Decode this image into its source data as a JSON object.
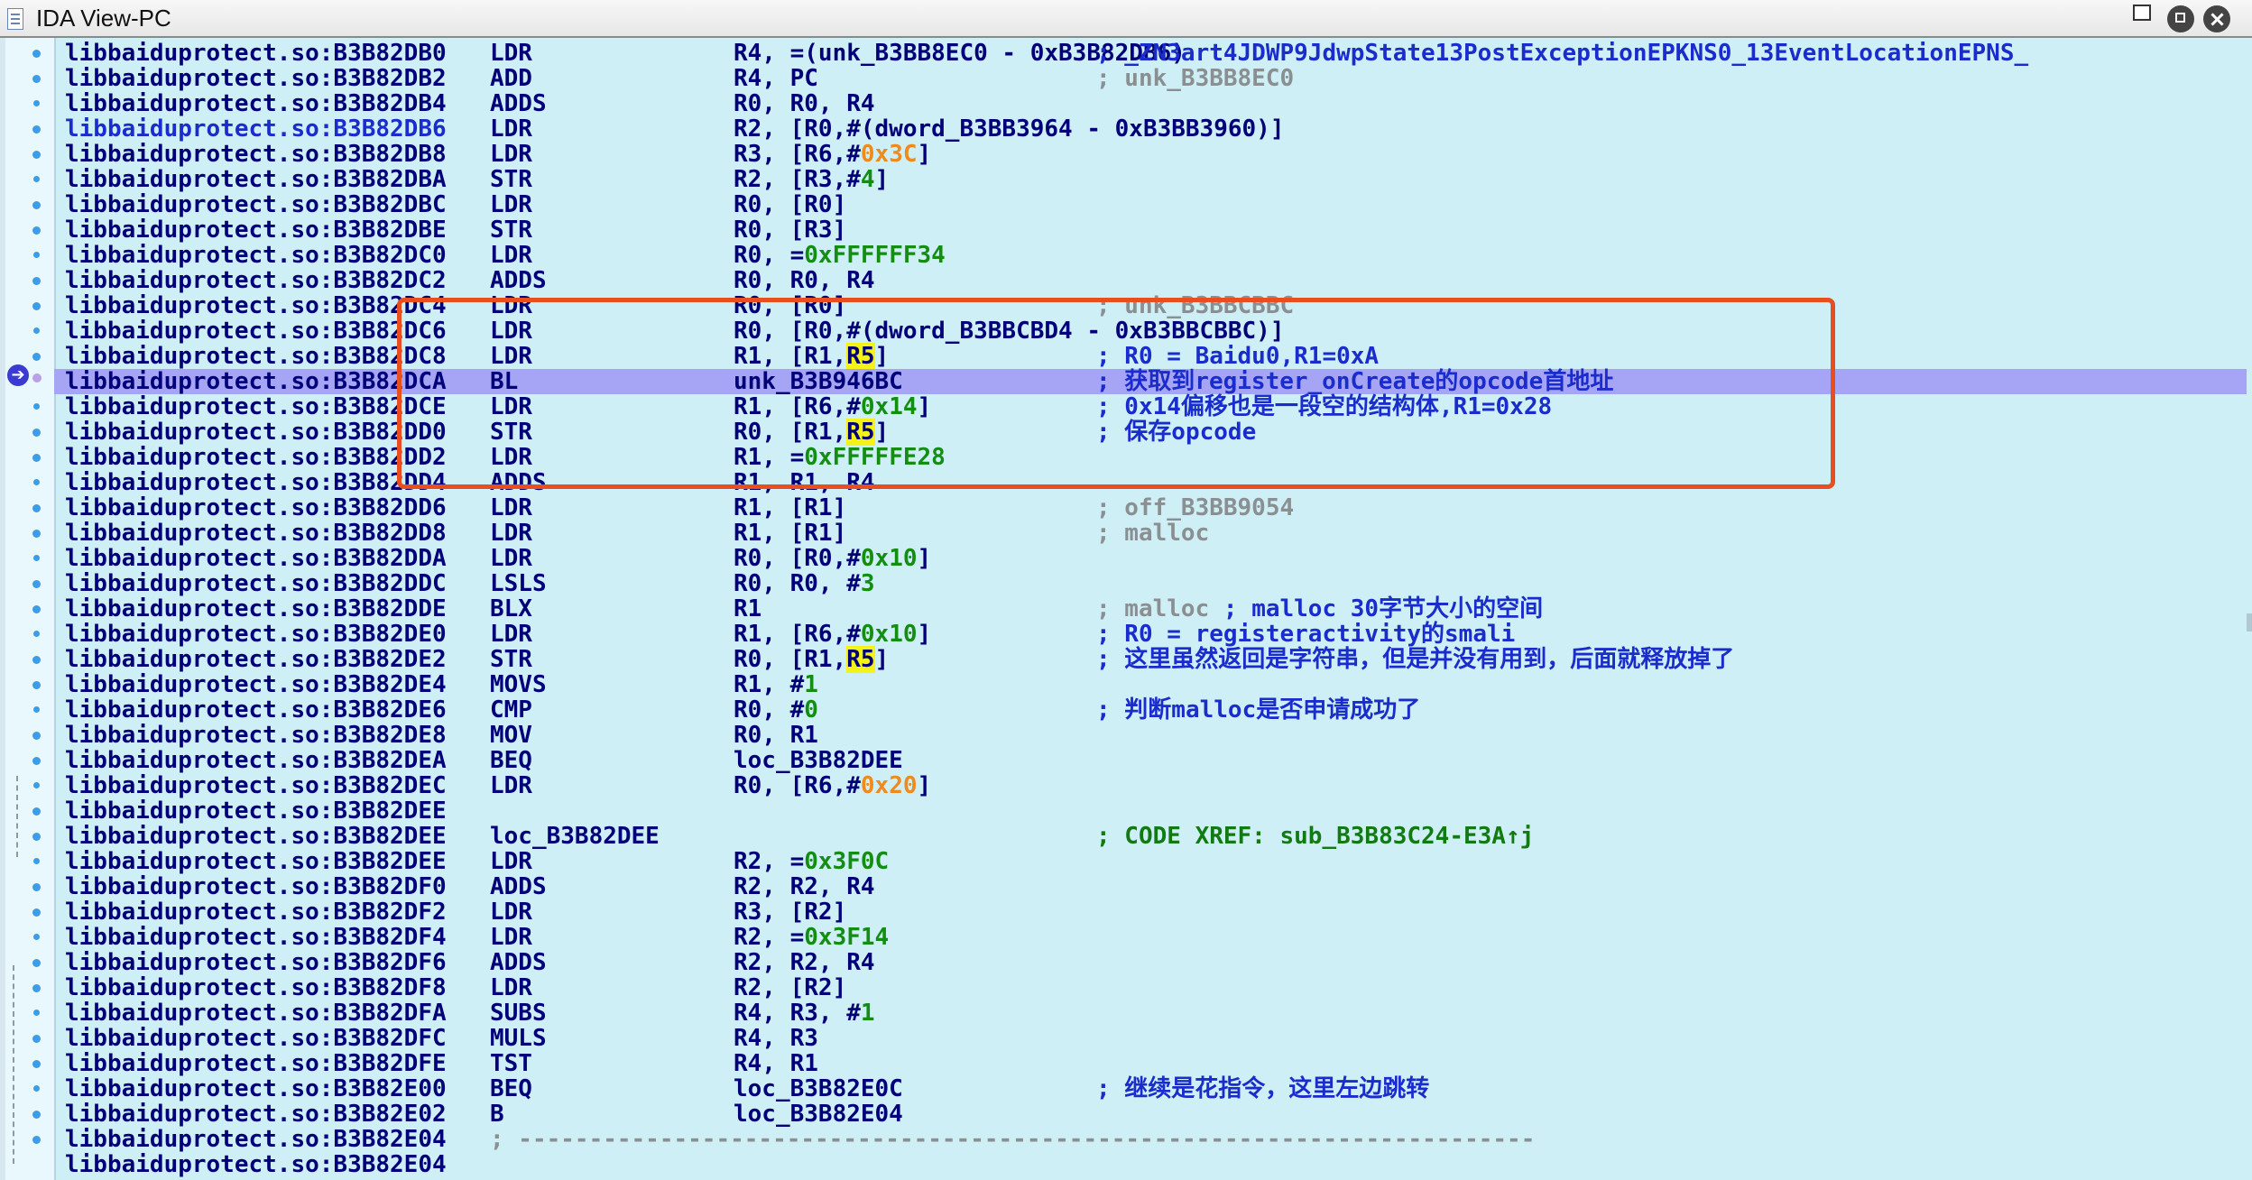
{
  "window": {
    "title": "IDA View-PC",
    "icons": [
      "document-icon",
      "restore-icon",
      "float-icon",
      "close-icon"
    ]
  },
  "lines": [
    {
      "addr": "libbaiduprotect.so:B3B82DB0",
      "mn": "LDR",
      "op": [
        {
          "t": "R4, =(unk_B3BB8EC0 - 0xB3B82DB6)"
        }
      ],
      "cm": "; _ZN3art4JDWP9JdwpState13PostExceptionEPKNS0_13EventLocationEPNS_",
      "cmc": "blue"
    },
    {
      "addr": "libbaiduprotect.so:B3B82DB2",
      "mn": "ADD",
      "op": [
        {
          "t": "R4, PC"
        }
      ],
      "cm": "; unk_B3BB8EC0",
      "cmc": "gray"
    },
    {
      "addr": "libbaiduprotect.so:B3B82DB4",
      "mn": "ADDS",
      "op": [
        {
          "t": "R0, R0, R4"
        }
      ]
    },
    {
      "addr": "libbaiduprotect.so:B3B82DB6",
      "addrc": "blue",
      "mn": "LDR",
      "op": [
        {
          "t": "R2, [R0,#(dword_B3BB3964 - 0xB3BB3960)]"
        }
      ]
    },
    {
      "addr": "libbaiduprotect.so:B3B82DB8",
      "mn": "LDR",
      "op": [
        {
          "t": "R3, [R6,#"
        },
        {
          "t": "0x3C",
          "c": "or"
        },
        {
          "t": "]"
        }
      ]
    },
    {
      "addr": "libbaiduprotect.so:B3B82DBA",
      "mn": "STR",
      "op": [
        {
          "t": "R2, [R3,#"
        },
        {
          "t": "4",
          "c": "gr"
        },
        {
          "t": "]"
        }
      ]
    },
    {
      "addr": "libbaiduprotect.so:B3B82DBC",
      "mn": "LDR",
      "op": [
        {
          "t": "R0, [R0]"
        }
      ]
    },
    {
      "addr": "libbaiduprotect.so:B3B82DBE",
      "mn": "STR",
      "op": [
        {
          "t": "R0, [R3]"
        }
      ]
    },
    {
      "addr": "libbaiduprotect.so:B3B82DC0",
      "mn": "LDR",
      "op": [
        {
          "t": "R0, ="
        },
        {
          "t": "0xFFFFFF34",
          "c": "gr"
        }
      ]
    },
    {
      "addr": "libbaiduprotect.so:B3B82DC2",
      "mn": "ADDS",
      "op": [
        {
          "t": "R0, R0, R4"
        }
      ]
    },
    {
      "addr": "libbaiduprotect.so:B3B82DC4",
      "mn": "LDR",
      "op": [
        {
          "t": "R0, [R0]"
        }
      ],
      "cm": "; unk_B3BBCBBC",
      "cmc": "gray"
    },
    {
      "addr": "libbaiduprotect.so:B3B82DC6",
      "mn": "LDR",
      "op": [
        {
          "t": "R0, [R0,#(dword_B3BBCBD4 - 0xB3BBCBBC)]"
        }
      ]
    },
    {
      "addr": "libbaiduprotect.so:B3B82DC8",
      "mn": "LDR",
      "op": [
        {
          "t": "R1, [R1,"
        },
        {
          "t": "R5",
          "c": "r5"
        },
        {
          "t": "]"
        }
      ],
      "cm": "; R0 = Baidu0,R1=0xA",
      "cmc": "blue"
    },
    {
      "addr": "libbaiduprotect.so:B3B82DCA",
      "mn": "BL",
      "op": [
        {
          "t": "unk_B3B946BC"
        }
      ],
      "cm": "; 获取到register_onCreate的opcode首地址",
      "cmc": "blue",
      "hl": true
    },
    {
      "addr": "libbaiduprotect.so:B3B82DCE",
      "mn": "LDR",
      "op": [
        {
          "t": "R1, [R6,#"
        },
        {
          "t": "0x14",
          "c": "gr"
        },
        {
          "t": "]"
        }
      ],
      "cm": "; 0x14偏移也是一段空的结构体,R1=0x28",
      "cmc": "blue"
    },
    {
      "addr": "libbaiduprotect.so:B3B82DD0",
      "mn": "STR",
      "op": [
        {
          "t": "R0, [R1,"
        },
        {
          "t": "R5",
          "c": "r5"
        },
        {
          "t": "]"
        }
      ],
      "cm": "; 保存opcode",
      "cmc": "blue"
    },
    {
      "addr": "libbaiduprotect.so:B3B82DD2",
      "mn": "LDR",
      "op": [
        {
          "t": "R1, ="
        },
        {
          "t": "0xFFFFFE28",
          "c": "gr"
        }
      ]
    },
    {
      "addr": "libbaiduprotect.so:B3B82DD4",
      "mn": "ADDS",
      "op": [
        {
          "t": "R1, R1, R4"
        }
      ]
    },
    {
      "addr": "libbaiduprotect.so:B3B82DD6",
      "mn": "LDR",
      "op": [
        {
          "t": "R1, [R1]"
        }
      ],
      "cm": "; off_B3BB9054",
      "cmc": "gray"
    },
    {
      "addr": "libbaiduprotect.so:B3B82DD8",
      "mn": "LDR",
      "op": [
        {
          "t": "R1, [R1]"
        }
      ],
      "cm": "; malloc",
      "cmc": "gray"
    },
    {
      "addr": "libbaiduprotect.so:B3B82DDA",
      "mn": "LDR",
      "op": [
        {
          "t": "R0, [R0,#"
        },
        {
          "t": "0x10",
          "c": "gr"
        },
        {
          "t": "]"
        }
      ]
    },
    {
      "addr": "libbaiduprotect.so:B3B82DDC",
      "mn": "LSLS",
      "op": [
        {
          "t": "R0, R0, #"
        },
        {
          "t": "3",
          "c": "gr"
        }
      ]
    },
    {
      "addr": "libbaiduprotect.so:B3B82DDE",
      "mn": "BLX",
      "op": [
        {
          "t": "R1"
        }
      ],
      "cmparts": [
        {
          "t": "; malloc",
          "c": "gray"
        },
        {
          "t": " ; malloc 30字节大小的空间",
          "c": "blue"
        }
      ]
    },
    {
      "addr": "libbaiduprotect.so:B3B82DE0",
      "mn": "LDR",
      "op": [
        {
          "t": "R1, [R6,#"
        },
        {
          "t": "0x10",
          "c": "gr"
        },
        {
          "t": "]"
        }
      ],
      "cm": "; R0 = registeractivity的smali",
      "cmc": "blue"
    },
    {
      "addr": "libbaiduprotect.so:B3B82DE2",
      "mn": "STR",
      "op": [
        {
          "t": "R0, [R1,"
        },
        {
          "t": "R5",
          "c": "r5"
        },
        {
          "t": "]"
        }
      ],
      "cm": "; 这里虽然返回是字符串，但是并没有用到，后面就释放掉了",
      "cmc": "blue"
    },
    {
      "addr": "libbaiduprotect.so:B3B82DE4",
      "mn": "MOVS",
      "op": [
        {
          "t": "R1, #"
        },
        {
          "t": "1",
          "c": "gr"
        }
      ]
    },
    {
      "addr": "libbaiduprotect.so:B3B82DE6",
      "mn": "CMP",
      "op": [
        {
          "t": "R0, #"
        },
        {
          "t": "0",
          "c": "gr"
        }
      ],
      "cm": "; 判断malloc是否申请成功了",
      "cmc": "blue"
    },
    {
      "addr": "libbaiduprotect.so:B3B82DE8",
      "mn": "MOV",
      "op": [
        {
          "t": "R0, R1"
        }
      ]
    },
    {
      "addr": "libbaiduprotect.so:B3B82DEA",
      "mn": "BEQ",
      "op": [
        {
          "t": "loc_B3B82DEE"
        }
      ]
    },
    {
      "addr": "libbaiduprotect.so:B3B82DEC",
      "mn": "LDR",
      "op": [
        {
          "t": "R0, [R6,#"
        },
        {
          "t": "0x20",
          "c": "or"
        },
        {
          "t": "]"
        }
      ]
    },
    {
      "addr": "libbaiduprotect.so:B3B82DEE",
      "mn": "",
      "op": []
    },
    {
      "addr": "libbaiduprotect.so:B3B82DEE",
      "mn": "loc_B3B82DEE",
      "op": [],
      "cm": "; CODE XREF: sub_B3B83C24-E3A↑j",
      "cmc": "green"
    },
    {
      "addr": "libbaiduprotect.so:B3B82DEE",
      "mn": "LDR",
      "op": [
        {
          "t": "R2, ="
        },
        {
          "t": "0x3F0C",
          "c": "gr"
        }
      ]
    },
    {
      "addr": "libbaiduprotect.so:B3B82DF0",
      "mn": "ADDS",
      "op": [
        {
          "t": "R2, R2, R4"
        }
      ]
    },
    {
      "addr": "libbaiduprotect.so:B3B82DF2",
      "mn": "LDR",
      "op": [
        {
          "t": "R3, [R2]"
        }
      ]
    },
    {
      "addr": "libbaiduprotect.so:B3B82DF4",
      "mn": "LDR",
      "op": [
        {
          "t": "R2, ="
        },
        {
          "t": "0x3F14",
          "c": "gr"
        }
      ]
    },
    {
      "addr": "libbaiduprotect.so:B3B82DF6",
      "mn": "ADDS",
      "op": [
        {
          "t": "R2, R2, R4"
        }
      ]
    },
    {
      "addr": "libbaiduprotect.so:B3B82DF8",
      "mn": "LDR",
      "op": [
        {
          "t": "R2, [R2]"
        }
      ]
    },
    {
      "addr": "libbaiduprotect.so:B3B82DFA",
      "mn": "SUBS",
      "op": [
        {
          "t": "R4, R3, #"
        },
        {
          "t": "1",
          "c": "gr"
        }
      ]
    },
    {
      "addr": "libbaiduprotect.so:B3B82DFC",
      "mn": "MULS",
      "op": [
        {
          "t": "R4, R3"
        }
      ]
    },
    {
      "addr": "libbaiduprotect.so:B3B82DFE",
      "mn": "TST",
      "op": [
        {
          "t": "R4, R1"
        }
      ]
    },
    {
      "addr": "libbaiduprotect.so:B3B82E00",
      "mn": "BEQ",
      "op": [
        {
          "t": "loc_B3B82E0C"
        }
      ],
      "cm": "; 继续是花指令，这里左边跳转",
      "cmc": "blue"
    },
    {
      "addr": "libbaiduprotect.so:B3B82E02",
      "mn": "B",
      "op": [
        {
          "t": "loc_B3B82E04"
        }
      ]
    },
    {
      "addr": "libbaiduprotect.so:B3B82E04",
      "mn": "; ------------------------------------------------------------------------",
      "mnc": "gray",
      "op": []
    },
    {
      "addr": "libbaiduprotect.so:B3B82E04",
      "mn": "",
      "op": []
    }
  ]
}
